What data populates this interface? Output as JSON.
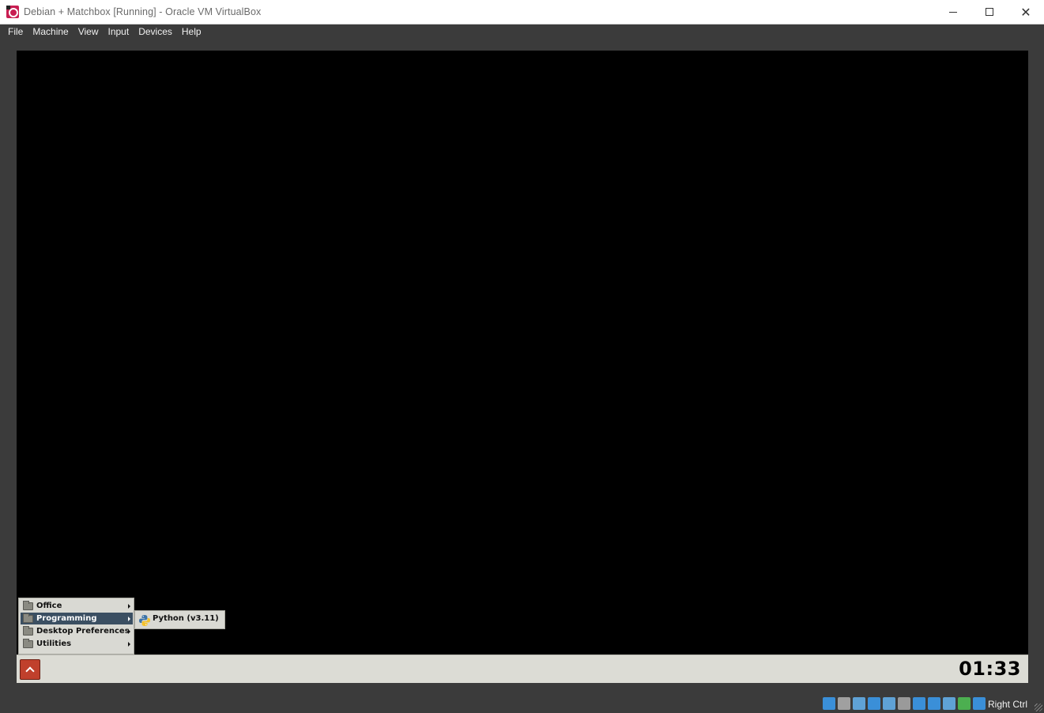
{
  "window": {
    "title": "Debian + Matchbox [Running] - Oracle VM VirtualBox",
    "icon": "virtualbox-app-icon"
  },
  "menubar": {
    "items": [
      "File",
      "Machine",
      "View",
      "Input",
      "Devices",
      "Help"
    ]
  },
  "start_menu": {
    "items": [
      {
        "label": "Office",
        "icon": "folder-icon",
        "has_submenu": true,
        "selected": false
      },
      {
        "label": "Programming",
        "icon": "folder-icon",
        "has_submenu": true,
        "selected": true
      },
      {
        "label": "Desktop Preferences",
        "icon": "folder-icon",
        "has_submenu": true,
        "selected": false
      },
      {
        "label": "Utilities",
        "icon": "folder-icon",
        "has_submenu": true,
        "selected": false
      }
    ]
  },
  "submenu": {
    "items": [
      {
        "label": "Python (v3.11)",
        "icon": "python-icon"
      }
    ]
  },
  "panel": {
    "clock": "01:33",
    "menu_button_icon": "chevron-up-icon"
  },
  "statusbar": {
    "icons": [
      "hard-disk-icon",
      "optical-drive-icon",
      "audio-icon",
      "network-icon",
      "usb-icon",
      "shared-folders-icon",
      "display-icon",
      "recording-icon",
      "vt-x-icon",
      "guest-additions-icon",
      "mouse-integration-icon"
    ],
    "icon_colors": [
      "#3a8fd8",
      "#a0a0a0",
      "#5fa2d6",
      "#3a8fd8",
      "#5fa2d6",
      "#9a9a9a",
      "#3a8fd8",
      "#3a8fd8",
      "#5fa2d6",
      "#4caf50",
      "#3a8fd8"
    ],
    "host_key": "Right Ctrl"
  }
}
